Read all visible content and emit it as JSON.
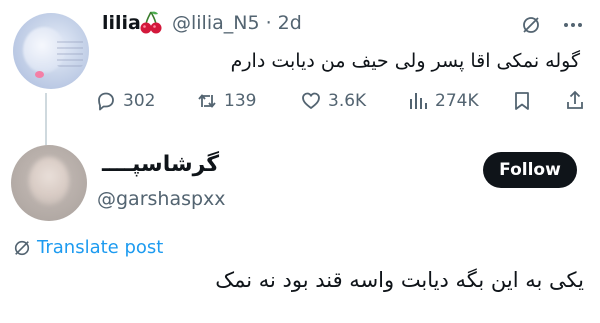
{
  "parent_tweet": {
    "display_name": "lilia",
    "name_emoji": "cherries-emoji",
    "handle_time": "@lilia_N5 · 2d",
    "text": "گوله نمکی اقا پسر ولی حیف من دیابت دارم",
    "actions": {
      "replies": "302",
      "reposts": "139",
      "likes": "3.6K",
      "views": "274K"
    }
  },
  "reply_tweet": {
    "display_name": "گرشاسپــــ",
    "handle": "@garshaspxx",
    "follow_label": "Follow",
    "translate_label": "Translate post",
    "text": "یکی به این بگه دیابت واسه قند بود نه نمک"
  },
  "colors": {
    "text": "#0f1419",
    "secondary": "#536471",
    "link": "#1d9bf0",
    "follow_bg": "#0f1419"
  }
}
